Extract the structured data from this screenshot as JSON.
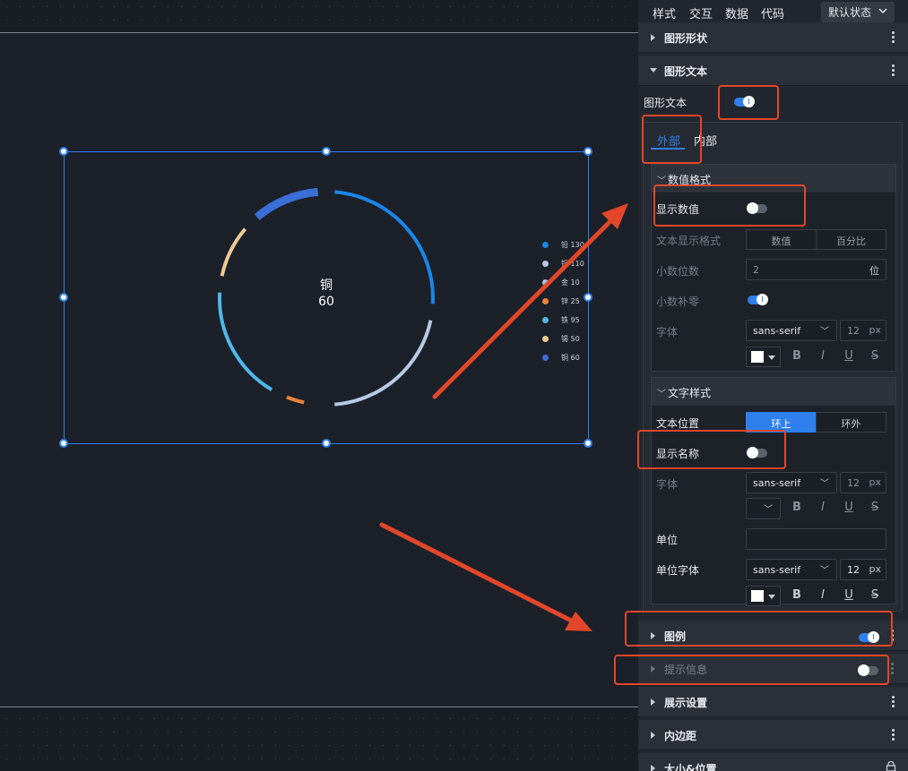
{
  "chart": {
    "center_name": "铜",
    "center_value": "60",
    "legend": [
      {
        "label": "铅",
        "value": "130",
        "color": "#1a86e8"
      },
      {
        "label": "铝",
        "value": "110",
        "color": "#b7c9e6"
      },
      {
        "label": "金",
        "value": "10",
        "color": "#a9c3e8"
      },
      {
        "label": "锌",
        "value": "25",
        "color": "#e8843a"
      },
      {
        "label": "铁",
        "value": "95",
        "color": "#4fb8e8"
      },
      {
        "label": "锡",
        "value": "50",
        "color": "#efc995"
      },
      {
        "label": "铜",
        "value": "60",
        "color": "#3a6fd8"
      }
    ]
  },
  "panel": {
    "tabs": [
      "样式",
      "交互",
      "数据",
      "代码"
    ],
    "status_select": "默认状态",
    "sections": {
      "graphic_shape": "图形形状",
      "graphic_text": "图形文本",
      "legend": "图例",
      "tooltip": "提示信息",
      "display_settings": "展示设置",
      "padding": "内边距",
      "size_position": "大小&位置"
    },
    "graphic_text_toggle_label": "图形文本",
    "subtabs": {
      "outer": "外部",
      "inner": "内部"
    },
    "value_format": {
      "title": "数值格式",
      "show_value": "显示数值",
      "display_format": "文本显示格式",
      "format_options": [
        "数值",
        "百分比"
      ],
      "decimals_label": "小数位数",
      "decimals_value": "2",
      "decimals_unit": "位",
      "pad_zero": "小数补零",
      "font_label": "字体",
      "font_family": "sans-serif",
      "font_size": "12",
      "font_unit": "px"
    },
    "text_style": {
      "title": "文字样式",
      "position_label": "文本位置",
      "position_options": [
        "环上",
        "环外"
      ],
      "show_name": "显示名称",
      "font_label": "字体",
      "font_family": "sans-serif",
      "font_size": "12",
      "font_unit": "px",
      "unit_label": "单位",
      "unit_value": "",
      "unit_font_label": "单位字体",
      "unit_font_family": "sans-serif",
      "unit_font_size": "12",
      "unit_font_unit": "px"
    },
    "format_buttons": [
      "B",
      "I",
      "U",
      "S"
    ]
  },
  "colors": {
    "accent": "#2f80ed",
    "annotation": "#e2472a",
    "canvas_bg": "#1b2029",
    "panel_bg": "#22262e"
  }
}
